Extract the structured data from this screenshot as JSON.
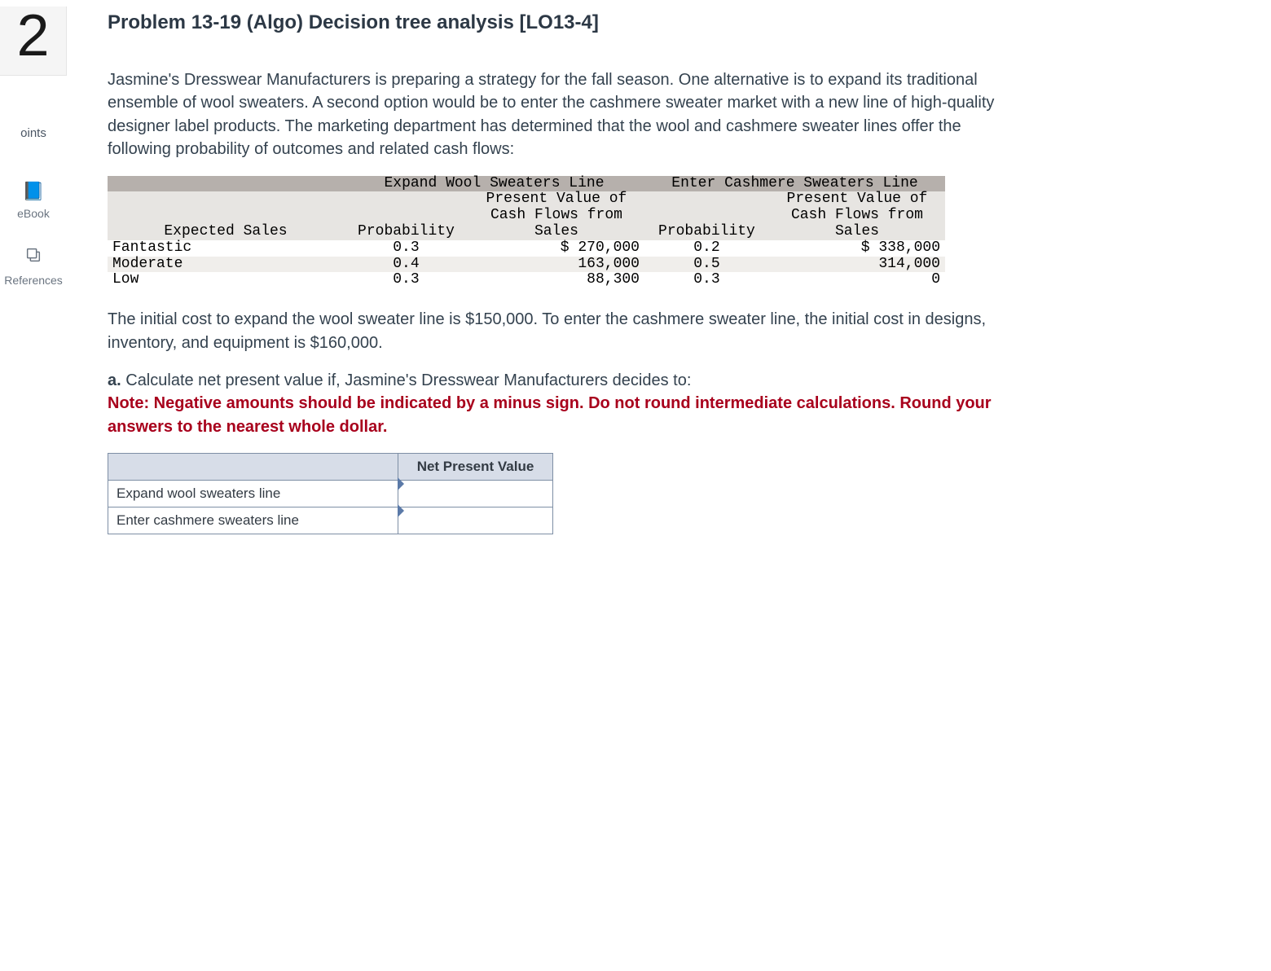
{
  "sidebar": {
    "question_number": "2",
    "points_label": "oints",
    "ebook_label": "eBook",
    "references_label": "References"
  },
  "title": "Problem 13-19 (Algo) Decision tree analysis [LO13-4]",
  "intro": "Jasmine's Dresswear Manufacturers is preparing a strategy for the fall season. One alternative is to expand its traditional ensemble of wool sweaters. A second option would be to enter the cashmere sweater market with a new line of high-quality designer label products. The marketing department has determined that the wool and cashmere sweater lines offer the following probability of outcomes and related cash flows:",
  "data_table": {
    "group_headers": [
      "Expand Wool Sweaters Line",
      "Enter Cashmere Sweaters Line"
    ],
    "pv_header_l1": "Present Value of",
    "pv_header_l2": "Cash Flows from",
    "row_labels_header": "Expected Sales",
    "col_prob": "Probability",
    "col_sales": "Sales",
    "rows": [
      {
        "label": "Fantastic",
        "p1": "0.3",
        "cf1": "$ 270,000",
        "p2": "0.2",
        "cf2": "$ 338,000"
      },
      {
        "label": "Moderate",
        "p1": "0.4",
        "cf1": "163,000",
        "p2": "0.5",
        "cf2": "314,000"
      },
      {
        "label": "Low",
        "p1": "0.3",
        "cf1": "88,300",
        "p2": "0.3",
        "cf2": "0"
      }
    ]
  },
  "cost_text": "The initial cost to expand the wool sweater line is $150,000. To enter the cashmere sweater line, the initial cost in designs, inventory, and equipment is $160,000.",
  "part_a_lead": "a.",
  "part_a_text": " Calculate net present value if, Jasmine's Dresswear Manufacturers decides to:",
  "note_text": "Note: Negative amounts should be indicated by a minus sign. Do not round intermediate calculations. Round your answers to the nearest whole dollar.",
  "answer_table": {
    "header": "Net Present Value",
    "rows": [
      "Expand wool sweaters line",
      "Enter cashmere sweaters line"
    ]
  }
}
